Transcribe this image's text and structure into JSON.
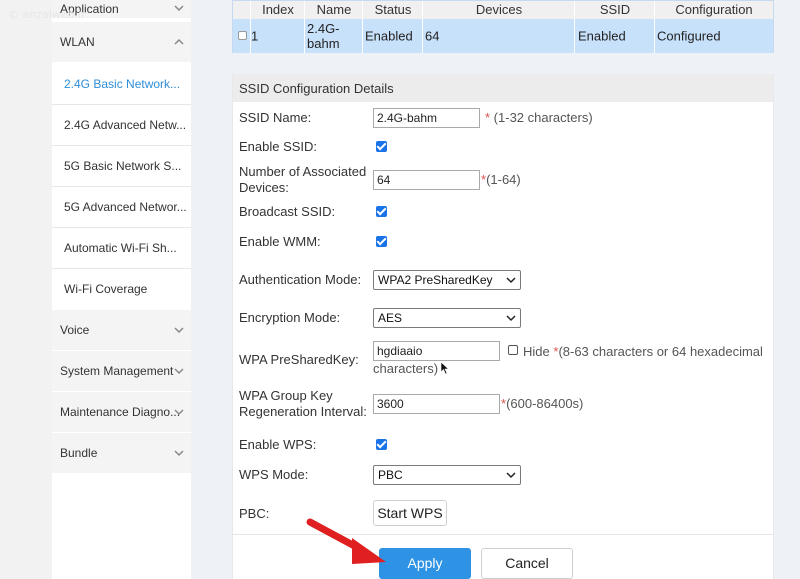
{
  "watermark": "anzalweb.ir",
  "sidebar": {
    "groups_top": [
      {
        "label": "Application",
        "chevron": "chevron-down"
      },
      {
        "label": "WLAN",
        "chevron": "chevron-up"
      }
    ],
    "wlan_items": [
      {
        "label": "2.4G Basic Network..."
      },
      {
        "label": "2.4G Advanced Netw..."
      },
      {
        "label": "5G Basic Network S..."
      },
      {
        "label": "5G Advanced Networ..."
      },
      {
        "label": "Automatic Wi-Fi Sh..."
      },
      {
        "label": "Wi-Fi Coverage"
      }
    ],
    "groups_bottom": [
      {
        "label": "Voice"
      },
      {
        "label": "System Management"
      },
      {
        "label": "Maintenance Diagno..."
      },
      {
        "label": "Bundle"
      }
    ]
  },
  "ssid_table": {
    "headers": [
      "Index",
      "Name",
      "Status",
      "Devices",
      "SSID",
      "Configuration"
    ],
    "row": {
      "index": "1",
      "name_line1": "2.4G-",
      "name_line2": "bahm",
      "status": "Enabled",
      "devices": "64",
      "ssid": "Enabled",
      "configuration": "Configured"
    }
  },
  "details": {
    "title": "SSID Configuration Details",
    "ssid_name": {
      "label": "SSID Name:",
      "value": "2.4G-bahm",
      "hint": " (1-32 characters)"
    },
    "enable_ssid": {
      "label": "Enable SSID:"
    },
    "assoc_devices": {
      "label_line1": "Number of Associated",
      "label_line2": "Devices:",
      "value": "64",
      "hint": "(1-64)"
    },
    "broadcast_ssid": {
      "label": "Broadcast SSID:"
    },
    "enable_wmm": {
      "label": "Enable WMM:"
    },
    "auth_mode": {
      "label": "Authentication Mode:",
      "value": "WPA2 PreSharedKey"
    },
    "encryption_mode": {
      "label": "Encryption Mode:",
      "value": "AES"
    },
    "psk": {
      "label": "WPA PreSharedKey:",
      "value": "hgdiaaio",
      "hide_label": "Hide",
      "hint_line1": "(8-63 characters or 64 hexadecimal",
      "hint_line2": "characters)"
    },
    "group_key": {
      "label_line1": "WPA Group Key",
      "label_line2": "Regeneration Interval:",
      "value": "3600",
      "hint": "(600-86400s)"
    },
    "enable_wps": {
      "label": "Enable WPS:"
    },
    "wps_mode": {
      "label": "WPS Mode:",
      "value": "PBC"
    },
    "pbc": {
      "label": "PBC:",
      "button": "Start WPS"
    },
    "required_mark": "*",
    "apply": "Apply",
    "cancel": "Cancel"
  },
  "colors": {
    "accent": "#2f93e5",
    "active_menu": "#2e8ed8",
    "row_selected": "#c8e1fb",
    "annotation_arrow": "#e02020"
  }
}
